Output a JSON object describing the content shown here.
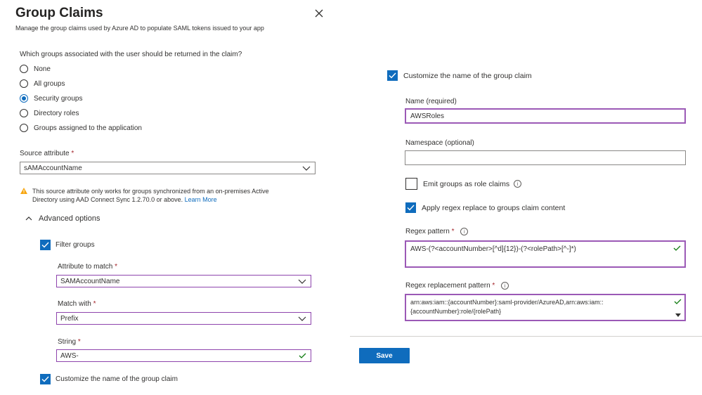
{
  "header": {
    "title": "Group Claims",
    "subtitle": "Manage the group claims used by Azure AD to populate SAML tokens issued to your app"
  },
  "groups_question": "Which groups associated with the user should be returned in the claim?",
  "group_options": [
    {
      "label": "None",
      "selected": false
    },
    {
      "label": "All groups",
      "selected": false
    },
    {
      "label": "Security groups",
      "selected": true
    },
    {
      "label": "Directory roles",
      "selected": false
    },
    {
      "label": "Groups assigned to the application",
      "selected": false
    }
  ],
  "source_attribute": {
    "label": "Source attribute",
    "required_mark": "*",
    "value": "sAMAccountName"
  },
  "warning": {
    "line1": "This source attribute only works for groups synchronized from an on-premises Active",
    "line2": "Directory using AAD Connect Sync 1.2.70.0 or above.",
    "link": "Learn More"
  },
  "advanced": {
    "label": "Advanced options",
    "filter_groups": {
      "label": "Filter groups",
      "checked": true
    },
    "attribute_to_match": {
      "label": "Attribute to match",
      "required_mark": "*",
      "value": "SAMAccountName"
    },
    "match_with": {
      "label": "Match with",
      "required_mark": "*",
      "value": "Prefix"
    },
    "string": {
      "label": "String",
      "required_mark": "*",
      "value": "AWS-"
    },
    "customize_left": {
      "label": "Customize the name of the group claim",
      "checked": true
    }
  },
  "right": {
    "customize": {
      "label": "Customize the name of the group claim",
      "checked": true
    },
    "name": {
      "label": "Name (required)",
      "value": "AWSRoles"
    },
    "namespace": {
      "label": "Namespace (optional)",
      "value": ""
    },
    "emit_roles": {
      "label": "Emit groups as role claims",
      "checked": false
    },
    "apply_regex": {
      "label": "Apply regex replace to groups claim content",
      "checked": true
    },
    "regex_pattern": {
      "label": "Regex pattern",
      "required_mark": "*",
      "value": "AWS-(?<accountNumber>[^d]{12})-(?<rolePath>[^-]*)"
    },
    "regex_replacement": {
      "label": "Regex replacement pattern",
      "required_mark": "*",
      "line1": "arn:aws:iam::{accountNumber}:saml-provider/AzureAD,arn:aws:iam::",
      "line2": "{accountNumber}:role/{rolePath}"
    },
    "save_label": "Save"
  },
  "colors": {
    "accent": "#0f6cbd",
    "required": "#a4262c",
    "valid": "#107c10",
    "focus_border": "#9b59b6",
    "warning": "#f7a50d"
  }
}
